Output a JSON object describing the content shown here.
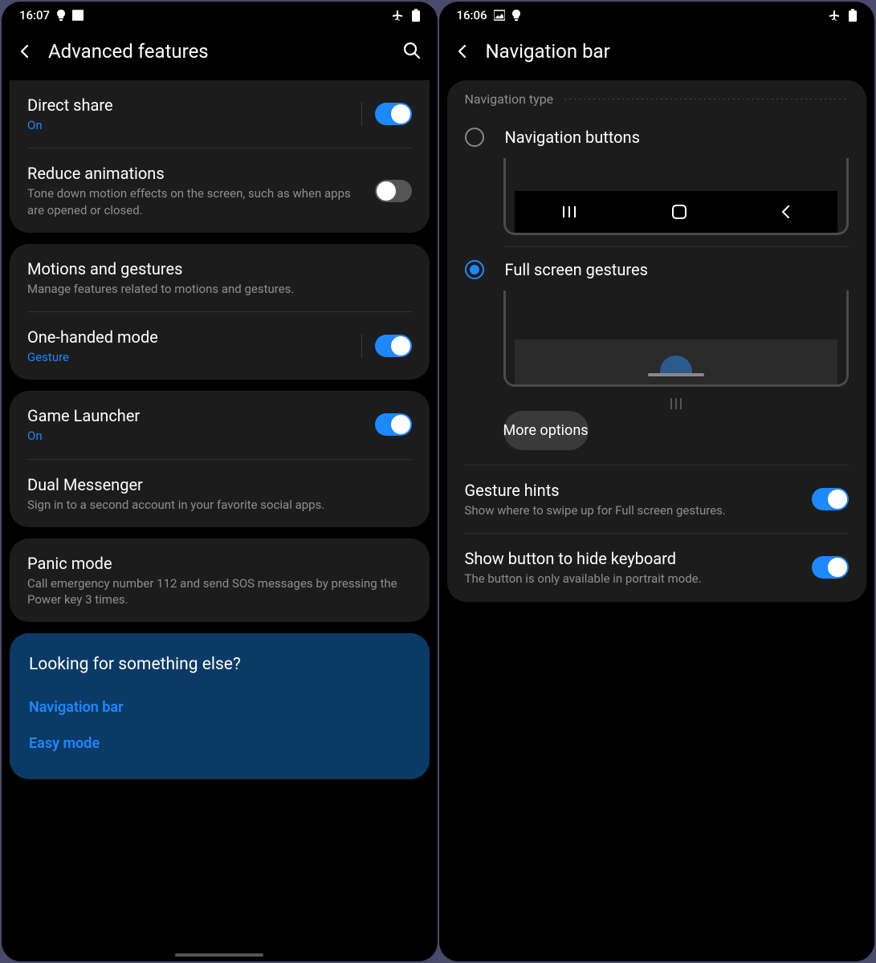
{
  "left": {
    "status": {
      "time": "16:07"
    },
    "header": {
      "title": "Advanced features"
    },
    "groups": [
      {
        "rows": [
          {
            "title": "Direct share",
            "sub": "On",
            "subBlue": true,
            "toggle": "on",
            "vline": true
          },
          {
            "title": "Reduce animations",
            "sub": "Tone down motion effects on the screen, such as when apps are opened or closed.",
            "toggle": "off"
          }
        ]
      },
      {
        "rows": [
          {
            "title": "Motions and gestures",
            "sub": "Manage features related to motions and gestures."
          },
          {
            "title": "One-handed mode",
            "sub": "Gesture",
            "subBlue": true,
            "toggle": "on",
            "vline": true
          }
        ]
      },
      {
        "rows": [
          {
            "title": "Game Launcher",
            "sub": "On",
            "subBlue": true,
            "toggle": "on"
          },
          {
            "title": "Dual Messenger",
            "sub": "Sign in to a second account in your favorite social apps."
          }
        ]
      },
      {
        "rows": [
          {
            "title": "Panic mode",
            "sub": "Call emergency number 112 and send SOS messages by pressing the Power key 3 times."
          }
        ]
      }
    ],
    "highlight": {
      "title": "Looking for something else?",
      "links": [
        "Navigation bar",
        "Easy mode"
      ]
    }
  },
  "right": {
    "status": {
      "time": "16:06"
    },
    "header": {
      "title": "Navigation bar"
    },
    "sectionLabel": "Navigation type",
    "option1": "Navigation buttons",
    "option2": "Full screen gestures",
    "moreOptions": "More options",
    "rows": [
      {
        "title": "Gesture hints",
        "sub": "Show where to swipe up for Full screen gestures.",
        "toggle": "on"
      },
      {
        "title": "Show button to hide keyboard",
        "sub": "The button is only available in portrait mode.",
        "toggle": "on"
      }
    ]
  }
}
